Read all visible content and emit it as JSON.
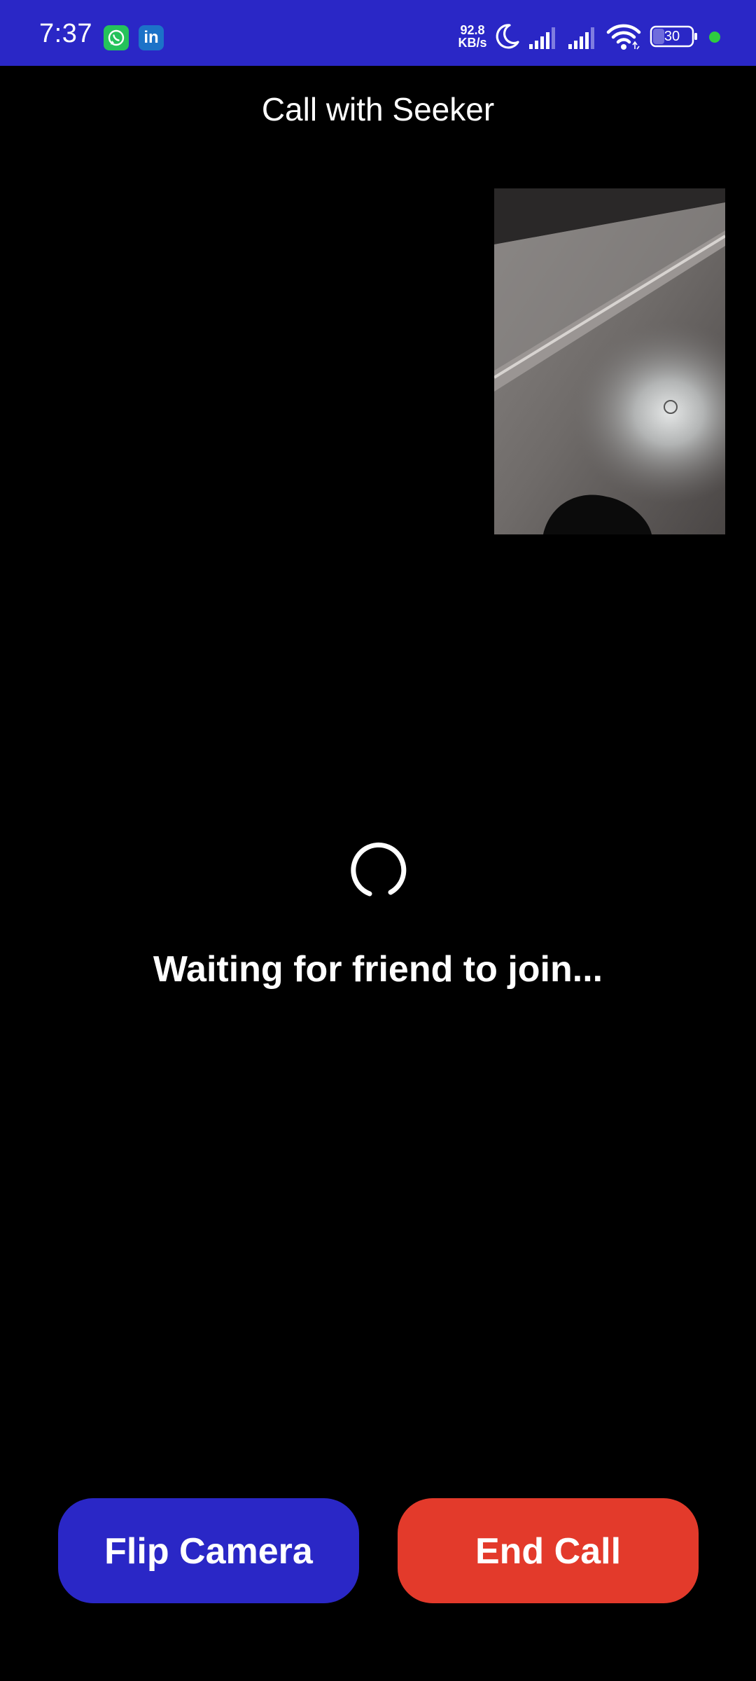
{
  "status_bar": {
    "time": "7:37",
    "net_speed_value": "92.8",
    "net_speed_unit": "KB/s",
    "battery_level": "30",
    "apps": [
      "whatsapp-icon",
      "linkedin-icon"
    ],
    "linkedin_glyph": "in",
    "colors": {
      "background": "#2a27c6",
      "dot": "#2ecc40"
    }
  },
  "header": {
    "title": "Call with Seeker"
  },
  "main": {
    "status_text": "Waiting for friend to join..."
  },
  "controls": {
    "flip_label": "Flip Camera",
    "end_label": "End Call",
    "colors": {
      "flip": "#2a27c6",
      "end": "#e33a2b"
    }
  }
}
